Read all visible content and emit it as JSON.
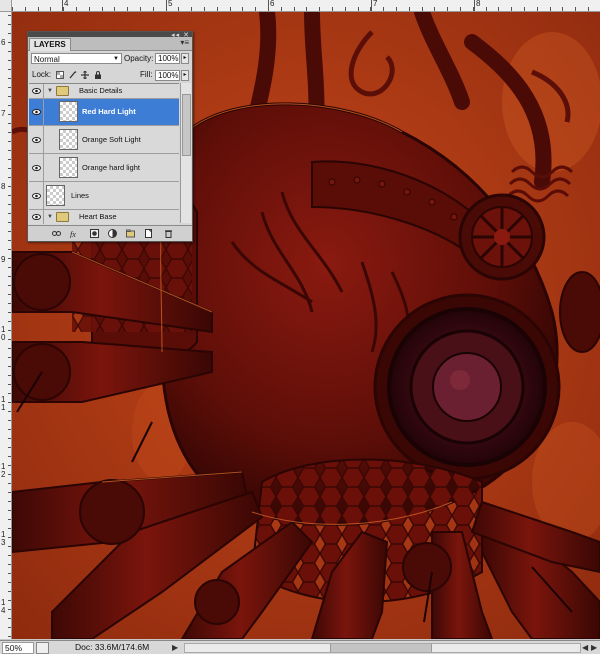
{
  "ruler": {
    "top_numbers": [
      "4",
      "5",
      "6",
      "7",
      "8"
    ],
    "left_numbers": [
      "6",
      "7",
      "8",
      "9",
      "1\n0",
      "1\n1",
      "1\n2",
      "1\n3",
      "1\n4"
    ]
  },
  "layers_panel": {
    "tab_label": "LAYERS",
    "blend_mode": "Normal",
    "opacity_label": "Opacity:",
    "opacity_value": "100%",
    "lock_label": "Lock:",
    "fill_label": "Fill:",
    "fill_value": "100%",
    "layers": [
      {
        "name": "Basic Details",
        "type": "group",
        "expanded": true
      },
      {
        "name": "Red Hard Light",
        "type": "layer",
        "selected": true
      },
      {
        "name": "Orange Soft Light",
        "type": "layer"
      },
      {
        "name": "Orange hard light",
        "type": "layer"
      },
      {
        "name": "Lines",
        "type": "layer"
      },
      {
        "name": "Heart Base",
        "type": "group",
        "expanded": true
      }
    ]
  },
  "status_bar": {
    "zoom": "50%",
    "doc_info": "Doc: 33.6M/174.6M"
  },
  "colors": {
    "selection": "#3d7dd6",
    "canvas_base": "#b13a14",
    "dark_red": "#4a0a06"
  }
}
